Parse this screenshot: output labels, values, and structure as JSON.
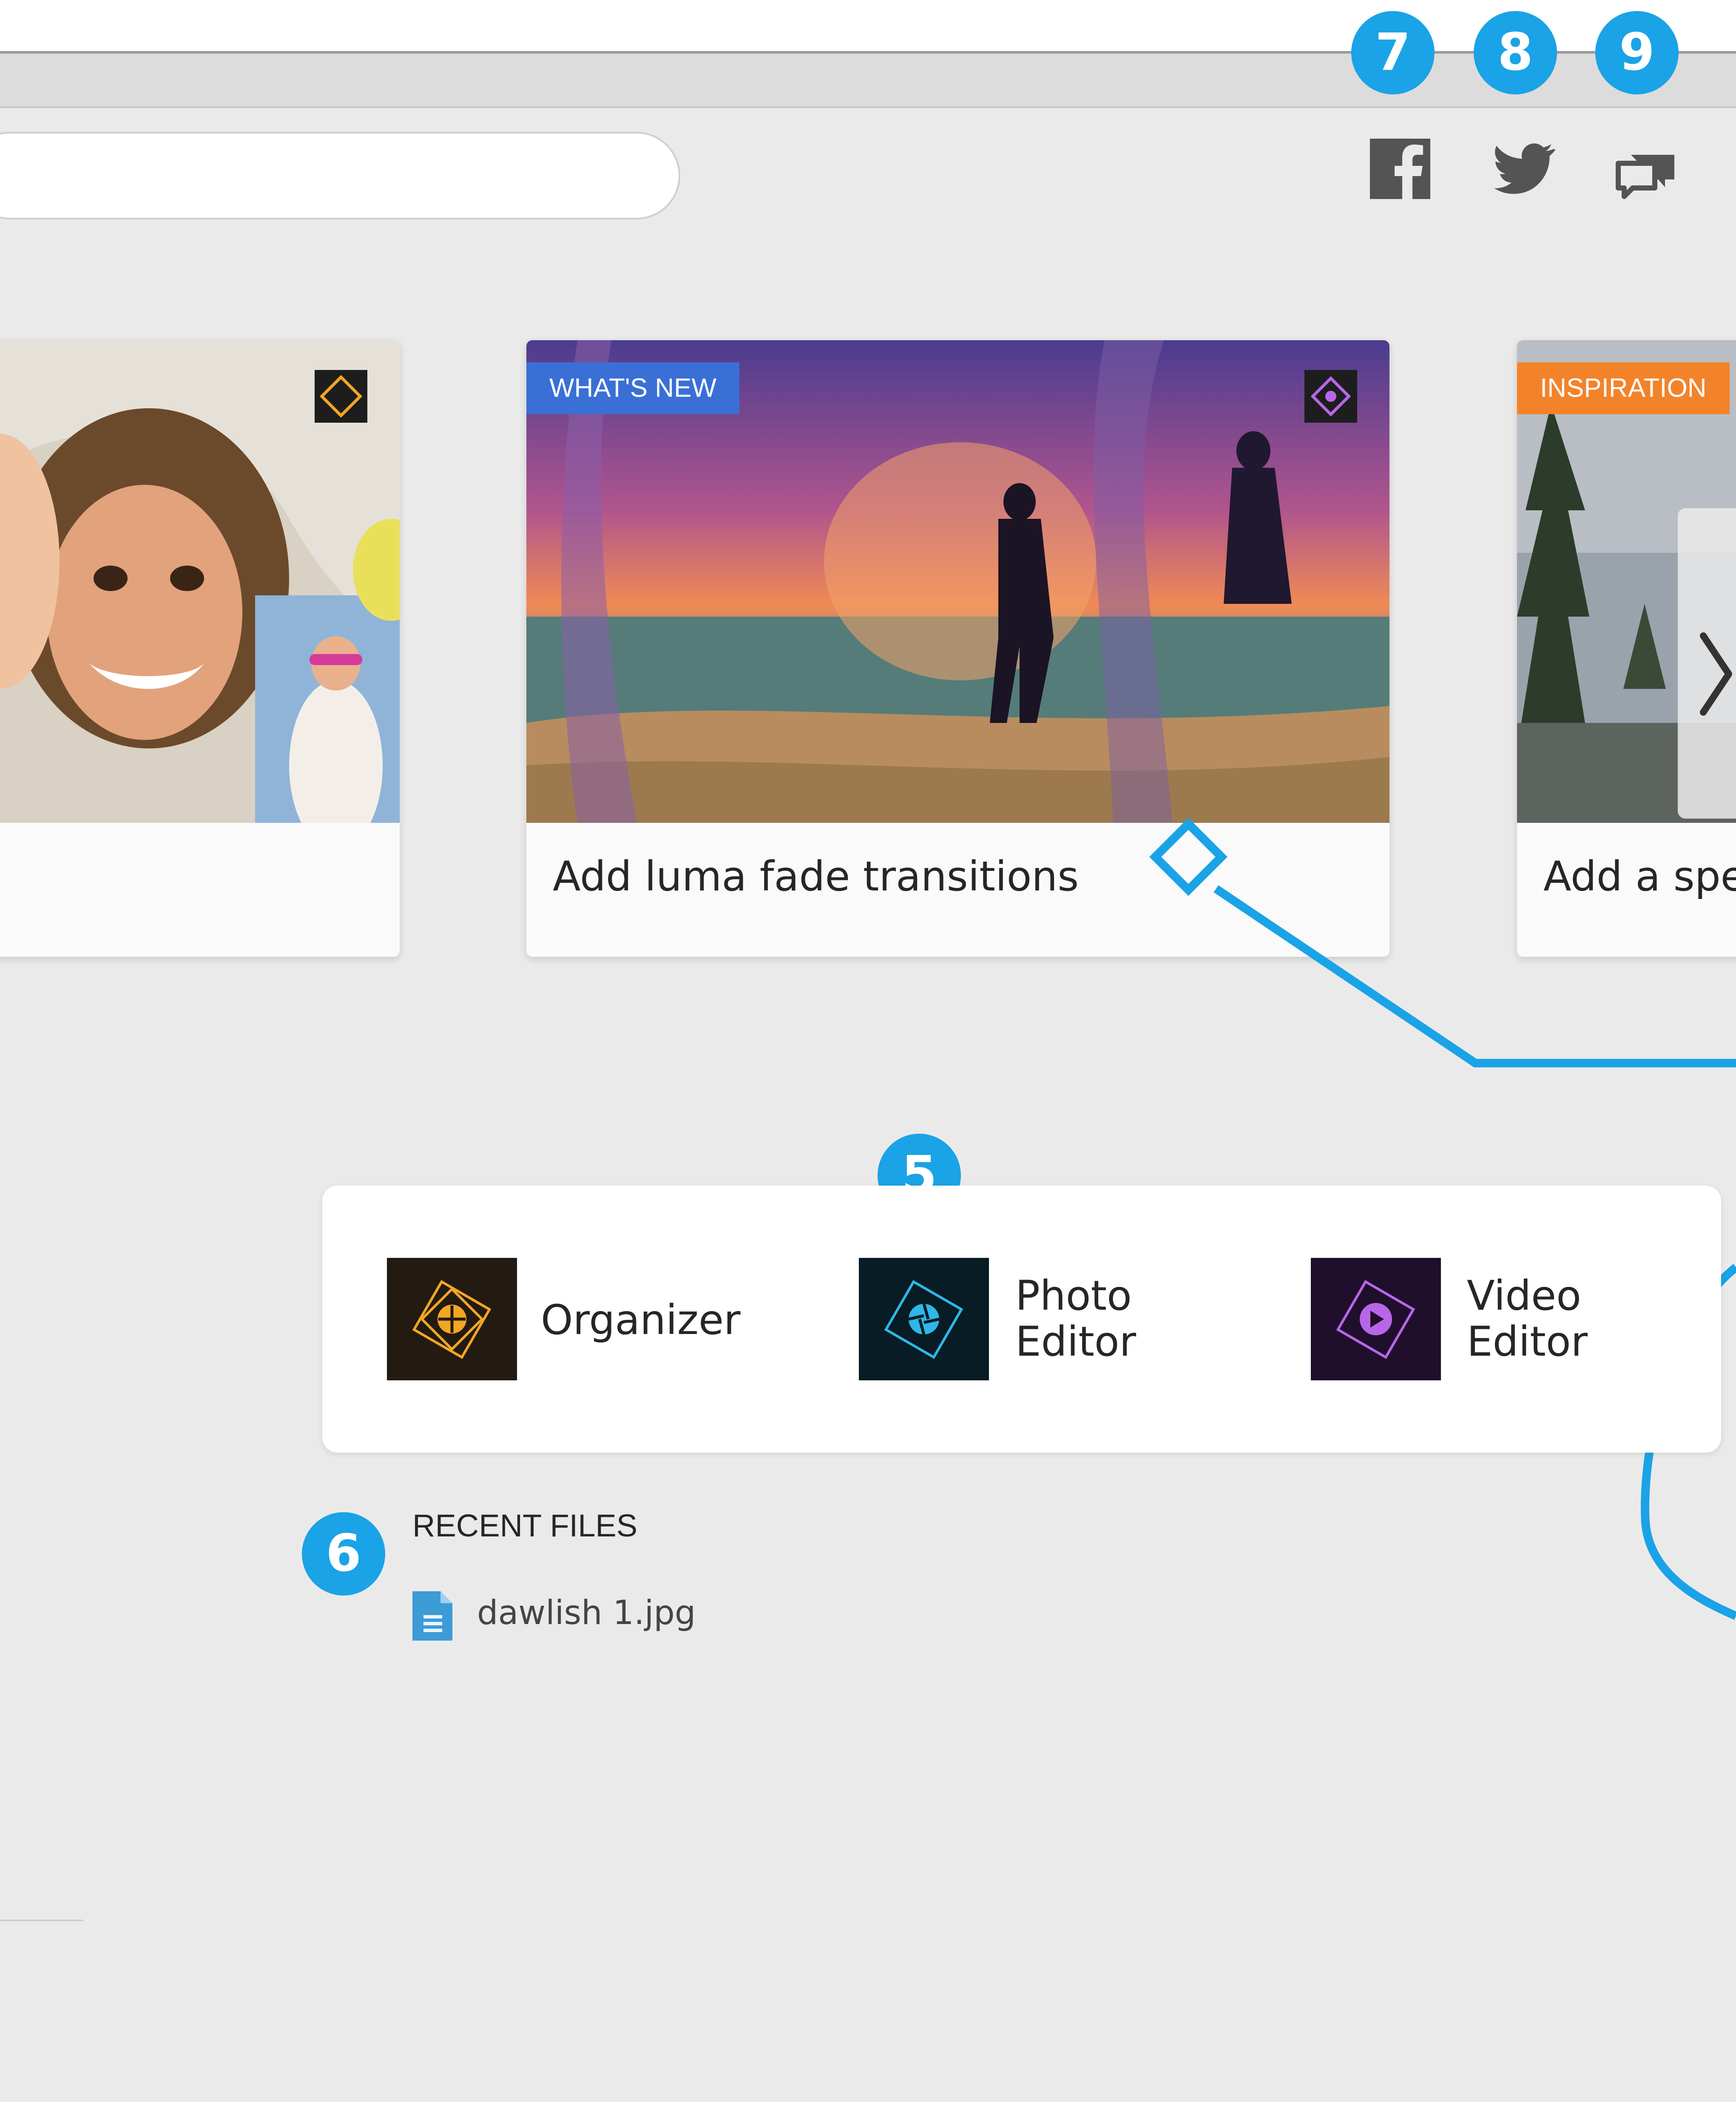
{
  "callouts": {
    "c5": "5",
    "c6": "6",
    "c7": "7",
    "c8": "8",
    "c9": "9"
  },
  "social": {
    "facebook_icon": "facebook-icon",
    "twitter_icon": "twitter-icon",
    "feedback_icon": "feedback-icon"
  },
  "cards": [
    {
      "title": "",
      "badge": "",
      "image": "photo-collage-smiling-children"
    },
    {
      "title": "Add luma fade transitions",
      "badge": "WHAT'S NEW",
      "badge_color": "#3a6fd6",
      "image": "beach-sunset-silhouettes"
    },
    {
      "title": "Add a spe",
      "badge": "INSPIRATION",
      "badge_color": "#f3832a",
      "image": "trees-cloudy-sky"
    }
  ],
  "launcher": {
    "organizer_label": "Organizer",
    "photo_editor_label_1": "Photo",
    "photo_editor_label_2": "Editor",
    "video_editor_label_1": "Video",
    "video_editor_label_2": "Editor"
  },
  "recent": {
    "heading": "RECENT FILES",
    "files": [
      "dawlish 1.jpg"
    ]
  },
  "colors": {
    "callout": "#1aa3e6",
    "organizer_accent": "#f2a623",
    "photo_accent": "#2eb7e8",
    "video_accent": "#b866e8"
  }
}
